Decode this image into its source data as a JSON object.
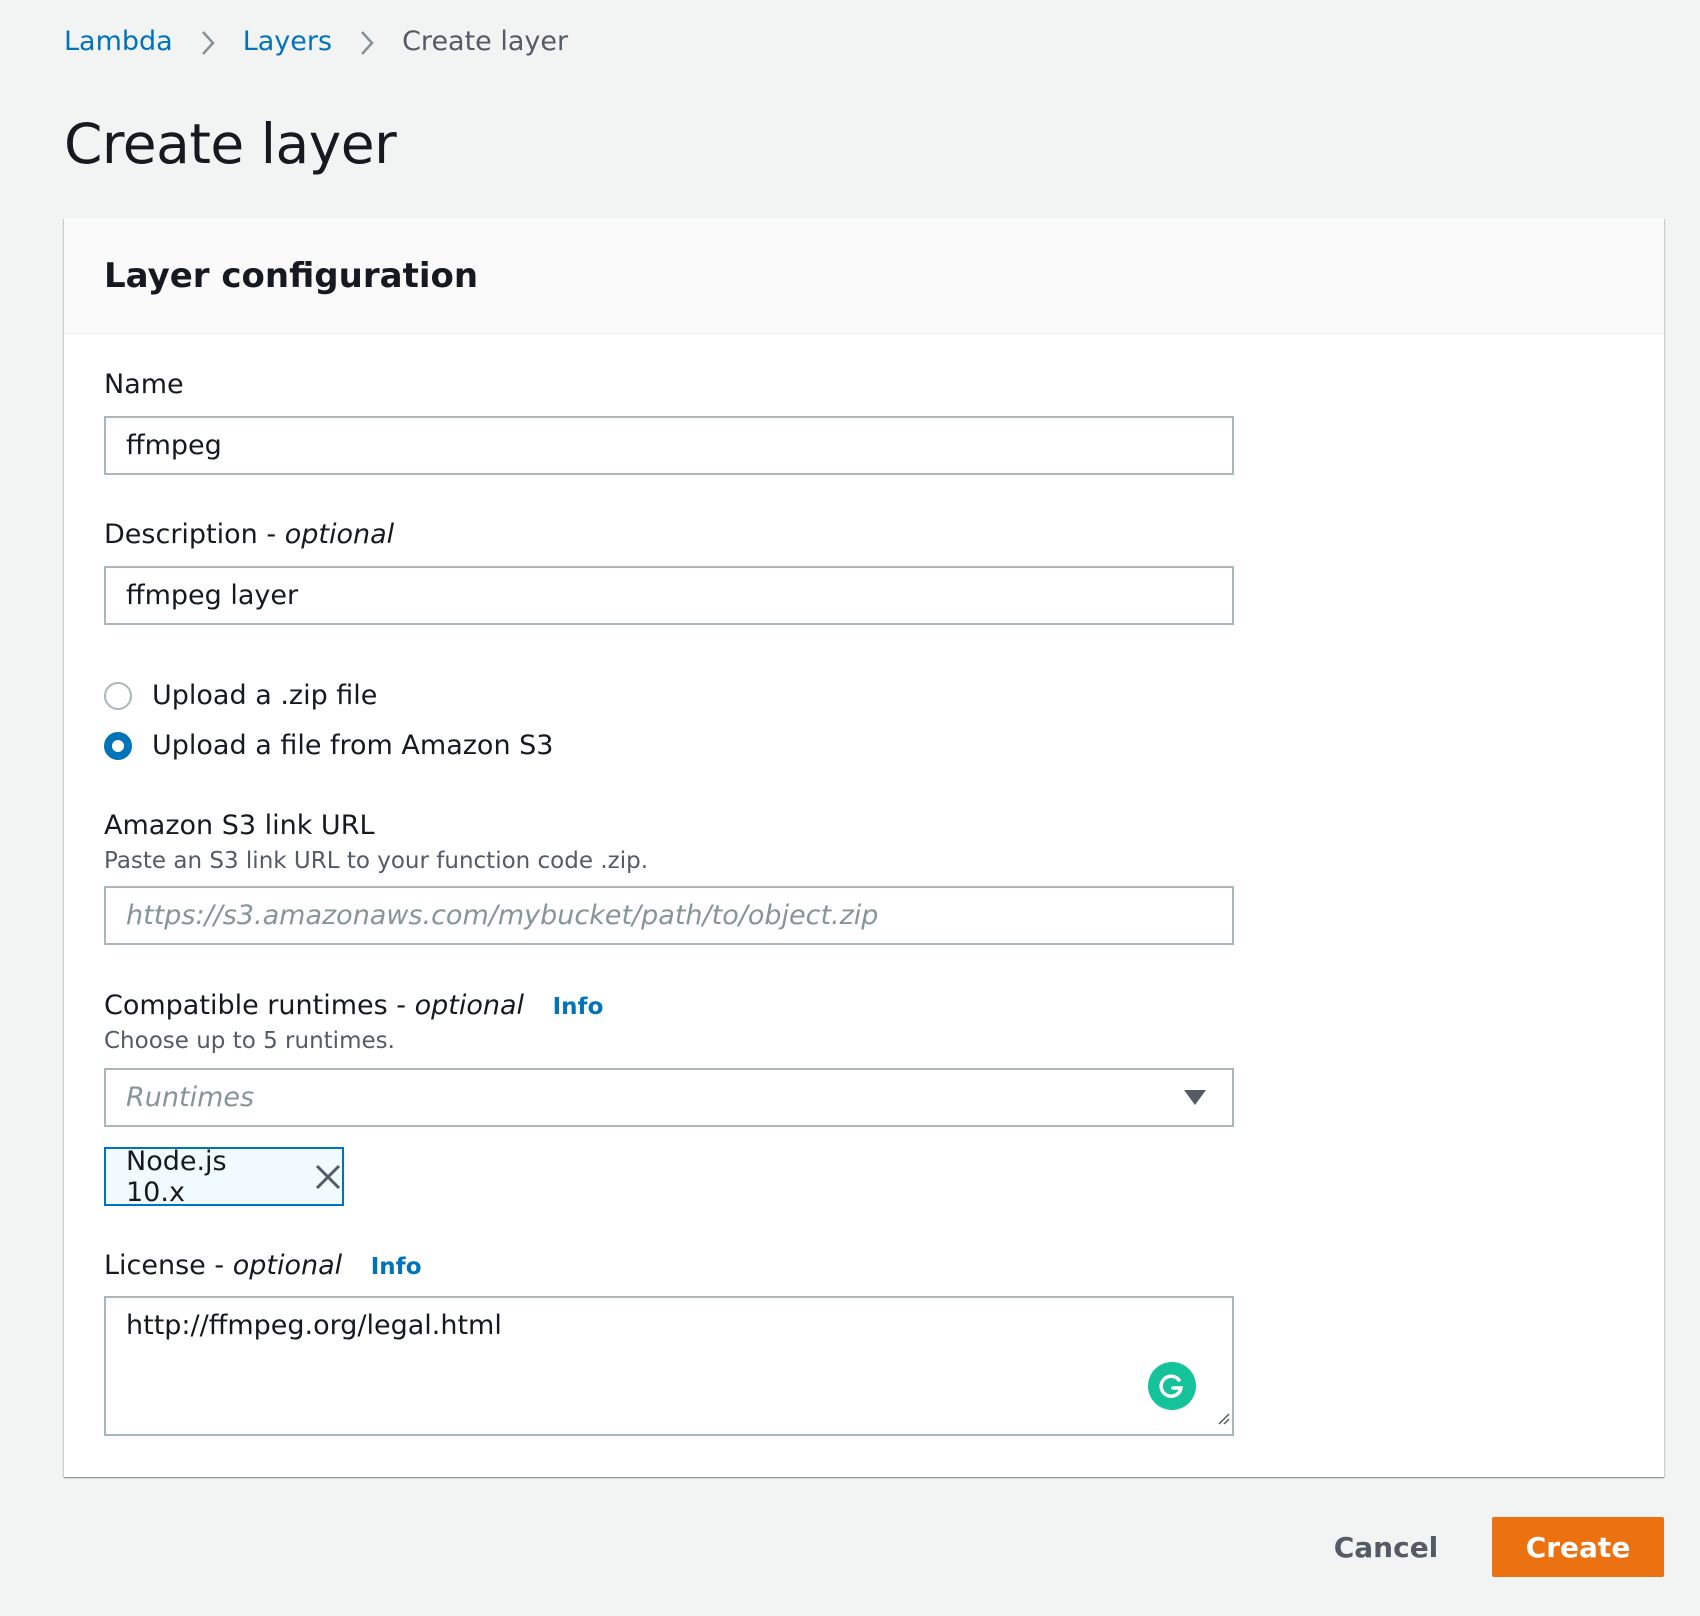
{
  "breadcrumb": {
    "items": [
      {
        "label": "Lambda"
      },
      {
        "label": "Layers"
      },
      {
        "label": "Create layer"
      }
    ]
  },
  "page": {
    "title": "Create layer"
  },
  "panel": {
    "title": "Layer configuration"
  },
  "form": {
    "name": {
      "label": "Name",
      "value": "ffmpeg"
    },
    "description": {
      "label": "Description -",
      "optional": "optional",
      "value": "ffmpeg layer"
    },
    "upload_options": [
      {
        "label": "Upload a .zip file",
        "checked": false
      },
      {
        "label": "Upload a file from Amazon S3",
        "checked": true
      }
    ],
    "s3_url": {
      "label": "Amazon S3 link URL",
      "hint": "Paste an S3 link URL to your function code .zip.",
      "placeholder": "https://s3.amazonaws.com/mybucket/path/to/object.zip"
    },
    "runtimes": {
      "label": "Compatible runtimes -",
      "optional": "optional",
      "info": "Info",
      "hint": "Choose up to 5 runtimes.",
      "placeholder": "Runtimes",
      "selected": [
        "Node.js 10.x"
      ]
    },
    "license": {
      "label": "License -",
      "optional": "optional",
      "info": "Info",
      "value": "http://ffmpeg.org/legal.html"
    }
  },
  "actions": {
    "cancel": "Cancel",
    "create": "Create"
  },
  "colors": {
    "link": "#0073bb",
    "primary_button": "#ec7211",
    "background": "#f2f3f3",
    "grammarly": "#15c39a"
  }
}
